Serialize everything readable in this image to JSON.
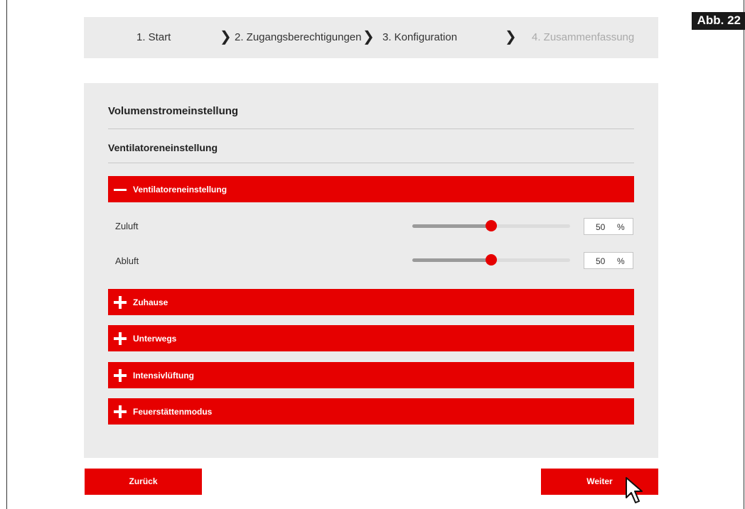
{
  "figure_label": "Abb. 22",
  "stepper": {
    "steps": [
      {
        "label": "1. Start",
        "state": "done"
      },
      {
        "label": "2. Zugangsberechtigungen",
        "state": "done"
      },
      {
        "label": "3. Konfiguration",
        "state": "active"
      },
      {
        "label": "4. Zusammenfassung",
        "state": "disabled"
      }
    ],
    "separator_icon": "chevron-right-icon"
  },
  "panel": {
    "title": "Volumenstromeinstellung",
    "subtitle": "Ventilatoreneinstellung",
    "accordions": [
      {
        "label": "Ventilatoreneinstellung",
        "expanded": true,
        "icon": "minus-icon"
      },
      {
        "label": "Zuhause",
        "expanded": false,
        "icon": "plus-icon"
      },
      {
        "label": "Unterwegs",
        "expanded": false,
        "icon": "plus-icon"
      },
      {
        "label": "Intensivlüftung",
        "expanded": false,
        "icon": "plus-icon"
      },
      {
        "label": "Feuerstättenmodus",
        "expanded": false,
        "icon": "plus-icon"
      }
    ],
    "sliders": [
      {
        "label": "Zuluft",
        "value": "50",
        "unit": "%",
        "fill_fraction": 0.5
      },
      {
        "label": "Abluft",
        "value": "50",
        "unit": "%",
        "fill_fraction": 0.5
      }
    ]
  },
  "buttons": {
    "back_label": "Zurück",
    "next_label": "Weiter"
  },
  "colors": {
    "accent": "#e60000",
    "panel_bg": "#ebebeb",
    "disabled_text": "#aaaaaa"
  },
  "cursor_icon": "mouse-pointer-icon"
}
